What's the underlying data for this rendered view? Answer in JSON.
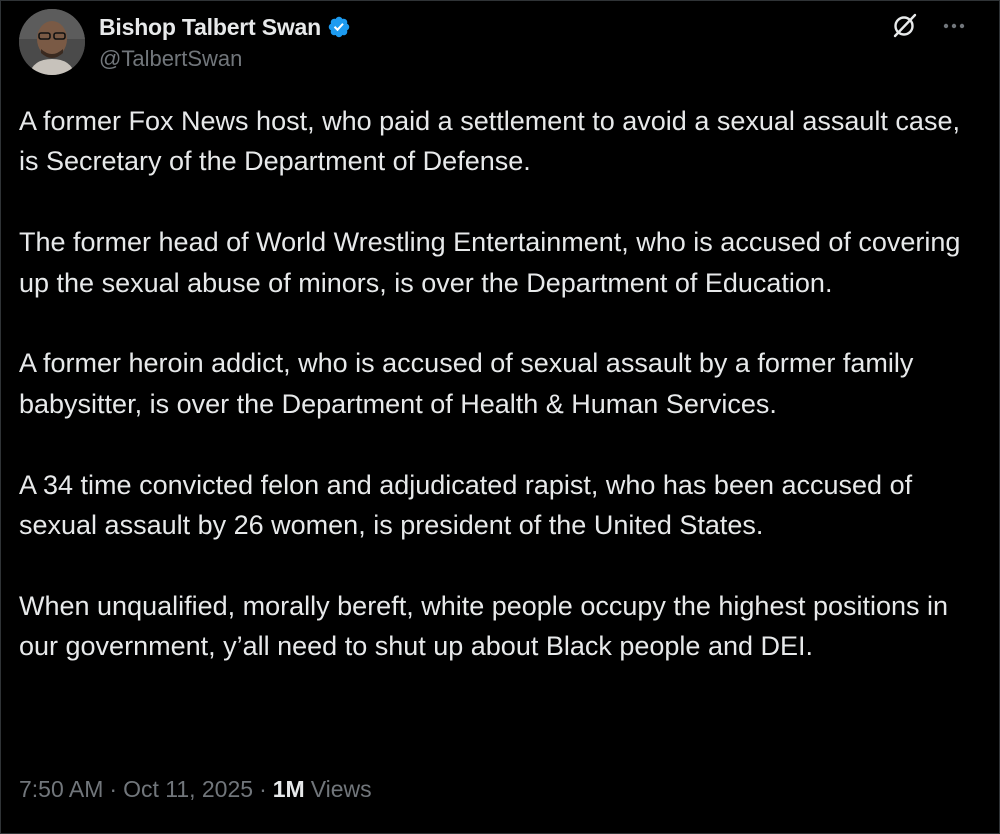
{
  "author": {
    "display_name": "Bishop Talbert Swan",
    "handle": "@TalbertSwan",
    "verified": true
  },
  "actions": {
    "grok_icon": "grok-slash-circle-icon",
    "more_icon": "more-horizontal-icon"
  },
  "tweet": {
    "paragraphs": [
      "A former Fox News host, who paid a settlement to avoid a sexual assault case, is Secretary of the Department of Defense.",
      "The former head of World Wrestling Entertainment, who is accused of covering up the sexual abuse of minors, is over the Department of Education.",
      "A former heroin addict, who is accused of sexual assault by a former family babysitter, is over the Department of Health & Human Services.",
      "A 34 time convicted felon and adjudicated rapist, who has been accused of sexual assault by 26 women, is president of the United States.",
      "When unqualified, morally bereft, white people occupy the highest positions in our government, y’all need to shut up about Black people and DEI."
    ]
  },
  "meta": {
    "time": "7:50 AM",
    "separator": "·",
    "date": "Oct 11, 2025",
    "views_count": "1M",
    "views_label": "Views"
  },
  "colors": {
    "background": "#000000",
    "text_primary": "#e7e9ea",
    "text_secondary": "#71767b",
    "verified_blue": "#1d9bf0"
  }
}
